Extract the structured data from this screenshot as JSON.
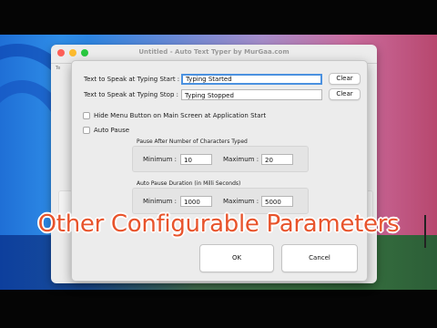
{
  "background_window": {
    "title": "Untitled - Auto Text Typer by MurGaa.com",
    "side_label": "Te"
  },
  "dialog": {
    "start_label": "Text to Speak at Typing Start :",
    "start_value": "Typing Started",
    "stop_label": "Text to Speak at Typing Stop :",
    "stop_value": "Typing Stopped",
    "clear_label": "Clear",
    "hide_menu_label": "Hide Menu Button on Main Screen at Application Start",
    "auto_pause_label": "Auto Pause",
    "chars_group_title": "Pause After Number of Characters Typed",
    "chars_min_label": "Minimum :",
    "chars_min_value": "10",
    "chars_max_label": "Maximum :",
    "chars_max_value": "20",
    "duration_group_title": "Auto Pause Duration (in Milli Seconds)",
    "dur_min_label": "Minimum :",
    "dur_min_value": "1000",
    "dur_max_label": "Maximum :",
    "dur_max_value": "5000",
    "ok_label": "OK",
    "cancel_label": "Cancel"
  },
  "overlay_caption": "Other Configurable Parameters",
  "colors": {
    "caption": "#e8542c",
    "focus_ring": "#4b91e0"
  }
}
